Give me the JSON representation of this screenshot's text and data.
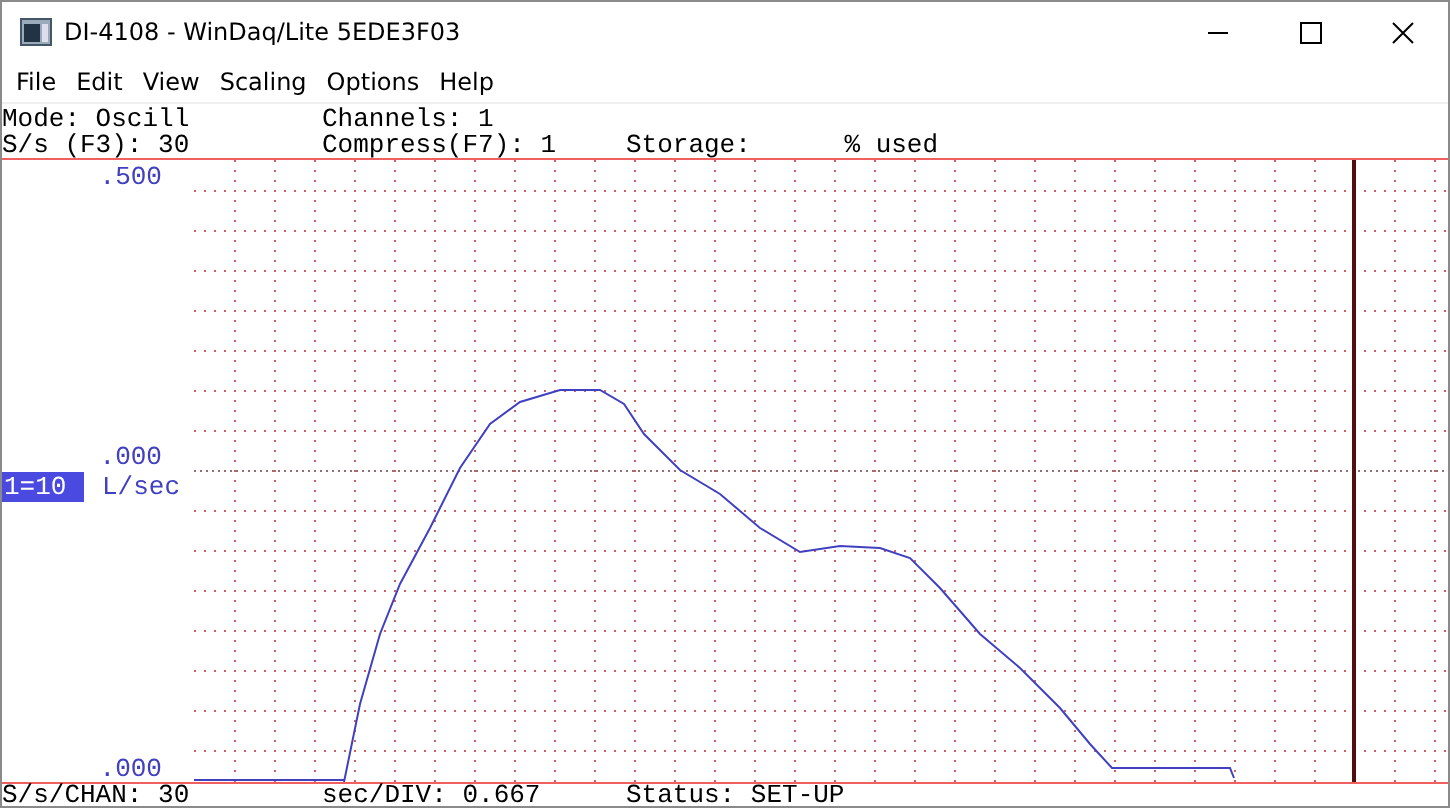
{
  "window": {
    "title": "DI-4108 - WinDaq/Lite 5EDE3F03"
  },
  "menu": [
    {
      "label": "File"
    },
    {
      "label": "Edit"
    },
    {
      "label": "View"
    },
    {
      "label": "Scaling"
    },
    {
      "label": "Options"
    },
    {
      "label": "Help"
    }
  ],
  "info_rows": [
    [
      "Mode: Oscill",
      "Channels: 1",
      ""
    ],
    [
      "S/s (F3): 30",
      "Compress(F7): 1",
      "Storage:      % used"
    ]
  ],
  "scale": {
    "top": ".500",
    "middle": ".000",
    "bottom": ".000",
    "channel": "1=10",
    "unit": "L/sec"
  },
  "status_bar": [
    "S/s/CHAN: 30",
    "sec/DIV: 0.667",
    "Status: SET-UP"
  ]
}
